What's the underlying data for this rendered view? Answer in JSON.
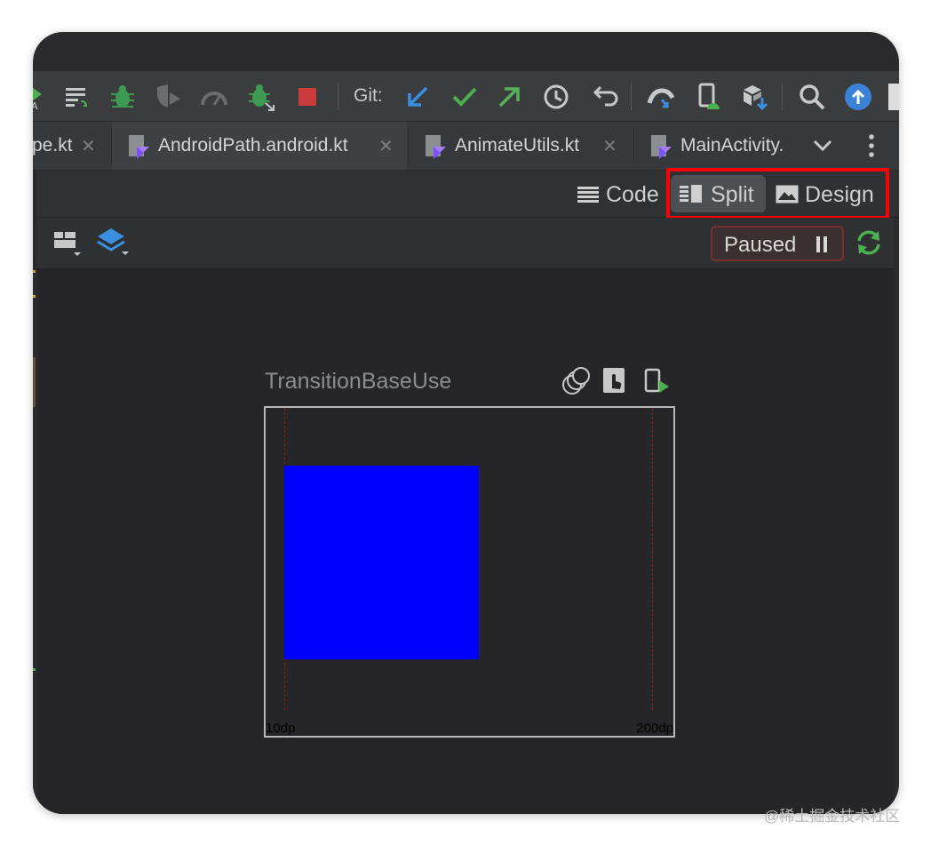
{
  "toolbar": {
    "git_label": "Git:",
    "icons": [
      "run-icon",
      "build-variants-icon",
      "debug-icon",
      "run-coverage-icon",
      "profile-icon",
      "attach-debugger-icon",
      "stop-icon",
      "git-update-icon",
      "git-commit-icon",
      "git-push-icon",
      "git-history-icon",
      "git-rollback-icon",
      "device-manager-icon",
      "device-mirror-icon",
      "sdk-manager-icon",
      "search-icon",
      "update-icon"
    ],
    "colors": {
      "debug": "#3d9a50",
      "stop": "#c93b3b",
      "update": "#3b82d6",
      "git_update": "#3b8fe0",
      "git_commit": "#4caf50",
      "git_push": "#56b15c"
    }
  },
  "tabs": [
    {
      "label": "pe.kt",
      "close": "✕",
      "active": false
    },
    {
      "label": "AndroidPath.android.kt",
      "close": "✕",
      "active": true
    },
    {
      "label": "AnimateUtils.kt",
      "close": "✕",
      "active": false
    },
    {
      "label": "MainActivity.",
      "close": "",
      "active": false
    }
  ],
  "view_modes": {
    "code": "Code",
    "split": "Split",
    "design": "Design",
    "selected": "Split"
  },
  "layout_toolbar": {
    "paused_label": "Paused"
  },
  "preview": {
    "title": "TransitionBaseUse",
    "left_label": "10dp",
    "right_label": "200dp",
    "box_color": "#0000ff"
  },
  "watermark": "@稀土掘金技术社区"
}
